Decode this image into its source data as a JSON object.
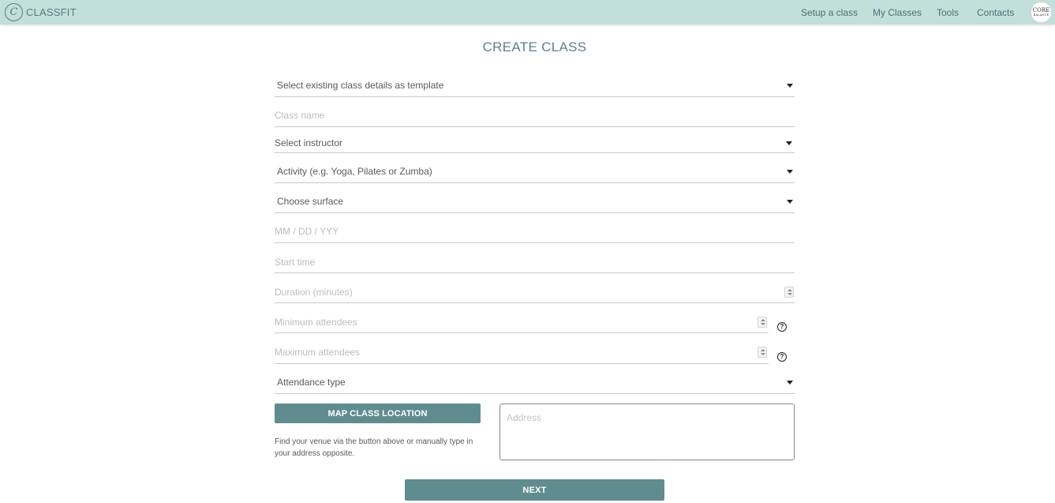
{
  "header": {
    "brand_mark": "C",
    "brand_name": "CLASSFIT",
    "nav": {
      "setup": "Setup a class",
      "my_classes": "My Classes",
      "tools": "Tools",
      "contacts": "Contacts"
    },
    "avatar": {
      "line1": "CORE",
      "line2": "BALANCE"
    }
  },
  "page": {
    "title": "CREATE CLASS"
  },
  "form": {
    "template_select": "Select existing class details as template",
    "class_name_placeholder": "Class name",
    "instructor_select": "Select instructor",
    "activity_select": "Activity (e.g. Yoga, Pilates or Zumba)",
    "surface_select": "Choose surface",
    "date_placeholder": "MM / DD / YYY",
    "start_time_placeholder": "Start time",
    "duration_placeholder": "Duration (minutes)",
    "min_attendees_placeholder": "Minimum attendees",
    "max_attendees_placeholder": "Maximum attendees",
    "attendance_type_select": "Attendance type",
    "help_glyph": "?",
    "map_button": "MAP CLASS LOCATION",
    "map_hint": "Find your venue via the button above or manually type in your address opposite.",
    "address_placeholder": "Address",
    "next_button": "NEXT"
  },
  "colors": {
    "topbar": "#c2dfd9",
    "accent": "#5f8d8f",
    "title": "#5b828c"
  },
  "icons": {
    "dropdown": "caret-down-icon",
    "stepper": "spinner-icon",
    "help": "help-circle-icon"
  }
}
